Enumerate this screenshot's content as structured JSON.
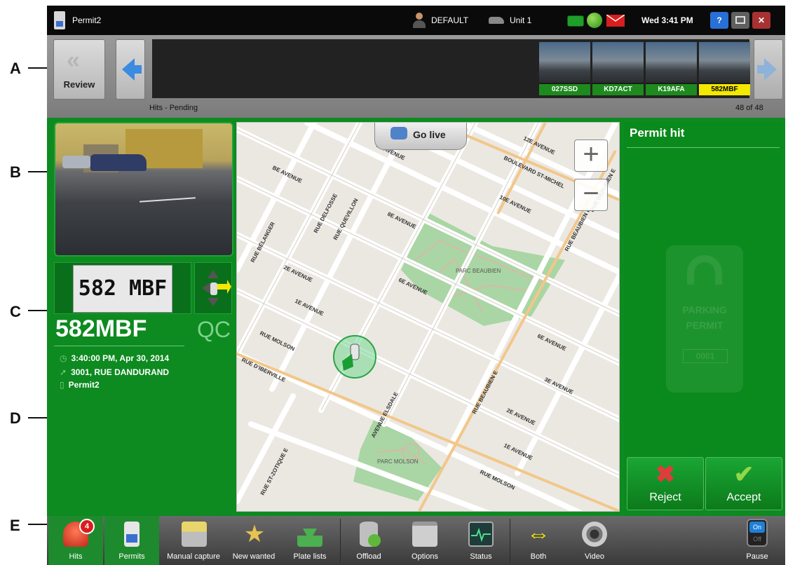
{
  "callouts": [
    "A",
    "B",
    "C",
    "D",
    "E"
  ],
  "titlebar": {
    "app_title": "Permit2",
    "user": "DEFAULT",
    "unit": "Unit 1",
    "datetime": "Wed 3:41 PM",
    "help_label": "?"
  },
  "strip": {
    "review_label": "Review",
    "status_label": "Hits - Pending",
    "count_label": "48 of 48",
    "thumbnails": [
      "027SSD",
      "KD7ACT",
      "K19AFA",
      "582MBF"
    ],
    "selected": "582MBF"
  },
  "read": {
    "plate_image_text": "582 MBF",
    "plate": "582MBF",
    "region": "QC",
    "timestamp": "3:40:00 PM, Apr 30, 2014",
    "address": "3001, RUE DANDURAND",
    "list_name": "Permit2"
  },
  "map": {
    "go_live_label": "Go live",
    "zoom_in": "+",
    "zoom_out": "−",
    "streets": [
      "12E AVENUE",
      "10E AVENUE",
      "BOULEVARD ST-MICHEL",
      "8E AVENUE",
      "2E AVENUE",
      "6E AVENUE",
      "1E AVENUE",
      "8E AVENUE",
      "6E AVENUE",
      "3E AVENUE",
      "2E AVENUE",
      "1E AVENUE",
      "RUE MOLSON",
      "RUE D'IBERVILLE",
      "RUE BÉLANGER",
      "RUE DELFOSSE",
      "RUE QUEVILLON",
      "RUE BEAUBIEN E",
      "RUE BEAUBIEN E",
      "RUE ST-ZOTIQUE E",
      "AVENUE ELSDALE",
      "RUE MOLSON",
      "RUE BEAUBIEN E",
      "BE AVENUE"
    ],
    "parks": [
      "PARC BEAUBIEN",
      "PARC MOLSON"
    ]
  },
  "hit_panel": {
    "title": "Permit hit",
    "watermark_lines": [
      "PARKING",
      "PERMIT"
    ],
    "watermark_code": "0001",
    "reject_label": "Reject",
    "accept_label": "Accept"
  },
  "bottombar": {
    "hits_badge": "4",
    "items": [
      "Hits",
      "Permits",
      "Manual capture",
      "New wanted",
      "Plate lists",
      "Offload",
      "Options",
      "Status",
      "Both",
      "Video",
      "Pause"
    ],
    "pause_on": "On",
    "pause_off": "Off"
  },
  "colors": {
    "panel_green": "#0d8a20",
    "selected_thumb": "#f2e800",
    "thumb_label": "#1e8a1e",
    "reject_red": "#e23b3b",
    "accept_green": "#8fd84a"
  }
}
